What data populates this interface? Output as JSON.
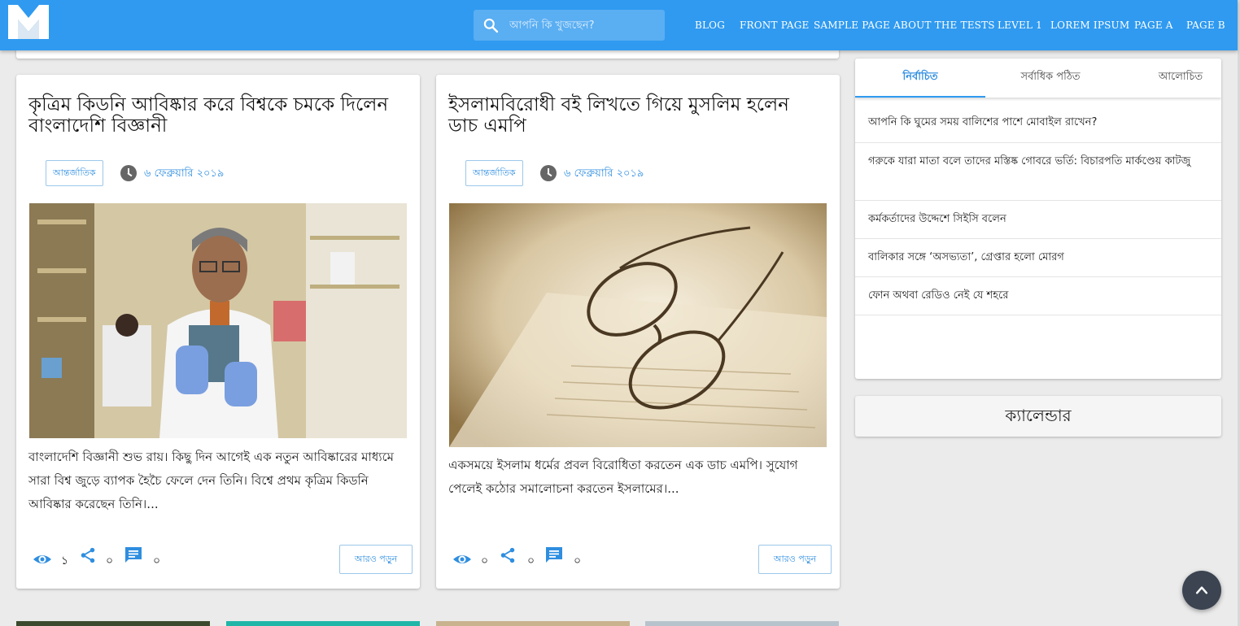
{
  "header": {
    "search": {
      "placeholder": "আপনি কি খুজছেন?"
    },
    "nav": [
      "BLOG",
      "FRONT PAGE",
      "SAMPLE PAGE",
      "ABOUT THE TESTS",
      "LEVEL 1",
      "LOREM IPSUM",
      "PAGE A",
      "PAGE B"
    ]
  },
  "posts": [
    {
      "title": "কৃত্রিম কিডনি আবিষ্কার করে বিশ্বকে চমকে দিলেন বাংলাদেশি বিজ্ঞানী",
      "category": "আন্তর্জাতিক",
      "date": "৬ ফেব্রুয়ারি ২০১৯",
      "excerpt": "বাংলাদেশি বিজ্ঞানী শুভ রায়। কিছু দিন আগেই এক নতুন আবিষ্কারের মাধ্যমে সারা বিশ্ব জুড়ে ব্যাপক হৈচৈ ফেলে দেন তিনি। বিশ্বে প্রথম কৃত্রিম কিডনি আবিষ্কার করেছেন তিনি।...",
      "views": "১",
      "shares": "০",
      "comments": "০",
      "read_more": "আরও পড়ুন"
    },
    {
      "title": "ইসলামবিরোধী বই লিখতে গিয়ে মুসলিম হলেন ডাচ এমপি",
      "category": "আন্তর্জাতিক",
      "date": "৬ ফেব্রুয়ারি ২০১৯",
      "excerpt": "একসময়ে ইসলাম ধর্মের প্রবল বিরোধিতা করতেন এক ডাচ এমপি। সুযোগ পেলেই কঠোর সমালোচনা করতেন ইসলামের।...",
      "views": "০",
      "shares": "০",
      "comments": "০",
      "read_more": "আরও পড়ুন"
    }
  ],
  "sidebar": {
    "tabs": [
      "নির্বাচিত",
      "সর্বাধিক পঠিত",
      "আলোচিত"
    ],
    "active_tab": "নির্বাচিত",
    "items": [
      "আপনি কি ঘুমের সময় বালিশের পাশে মোবাইল রাখেন?",
      "গরুকে যারা মাতা বলে তাদের মস্তিষ্ক গোবরে ভর্তি: বিচারপতি মার্কণ্ডেয় কাটজু",
      "কর্মকর্তাদের উদ্দেশে সিইসি বলেন",
      "বালিকার সঙ্গে ‘অসভ্যতা’, গ্রেপ্তার হলো মোরগ",
      "ফোন অথবা রেডিও নেই যে শহরে"
    ]
  },
  "calendar": {
    "title": "ক্যালেন্ডার"
  },
  "colors": {
    "primary": "#2f9af0",
    "accent_text": "#2f8ee0",
    "fab": "#3b4450"
  },
  "icons": [
    "logo-icon",
    "search-icon",
    "clock-icon",
    "eye-icon",
    "share-icon",
    "comment-icon",
    "chevron-up-icon"
  ]
}
